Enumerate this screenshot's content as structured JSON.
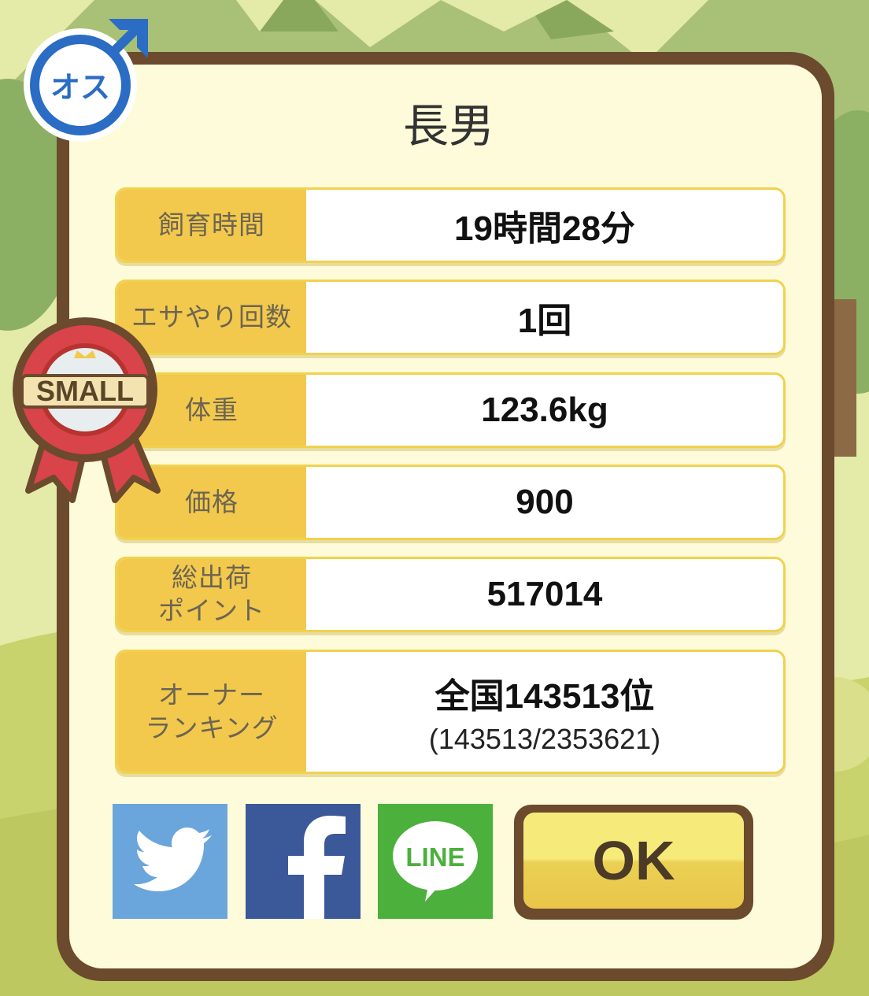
{
  "badge": {
    "gender_text": "オス"
  },
  "ribbon": {
    "text": "SMALL"
  },
  "title": "長男",
  "stats": [
    {
      "label": "飼育時間",
      "value": "19時間28分"
    },
    {
      "label": "エサやり回数",
      "value": "1回"
    },
    {
      "label": "体重",
      "value": "123.6kg"
    },
    {
      "label": "価格",
      "value": "900"
    },
    {
      "label_line1": "総出荷",
      "label_line2": "ポイント",
      "value": "517014"
    },
    {
      "label_line1": "オーナー",
      "label_line2": "ランキング",
      "value": "全国143513位",
      "sub": "(143513/2353621)"
    }
  ],
  "buttons": {
    "twitter_icon": "twitter-icon",
    "facebook_icon": "facebook-icon",
    "line_text": "LINE",
    "ok": "OK"
  },
  "colors": {
    "panel_border": "#6b4a2d",
    "label_bg": "#f2c94c",
    "twitter": "#6aa6dc",
    "facebook": "#3b5898",
    "line": "#4cb03d",
    "male_blue": "#2b6cc4",
    "ribbon_red": "#d9434a"
  }
}
